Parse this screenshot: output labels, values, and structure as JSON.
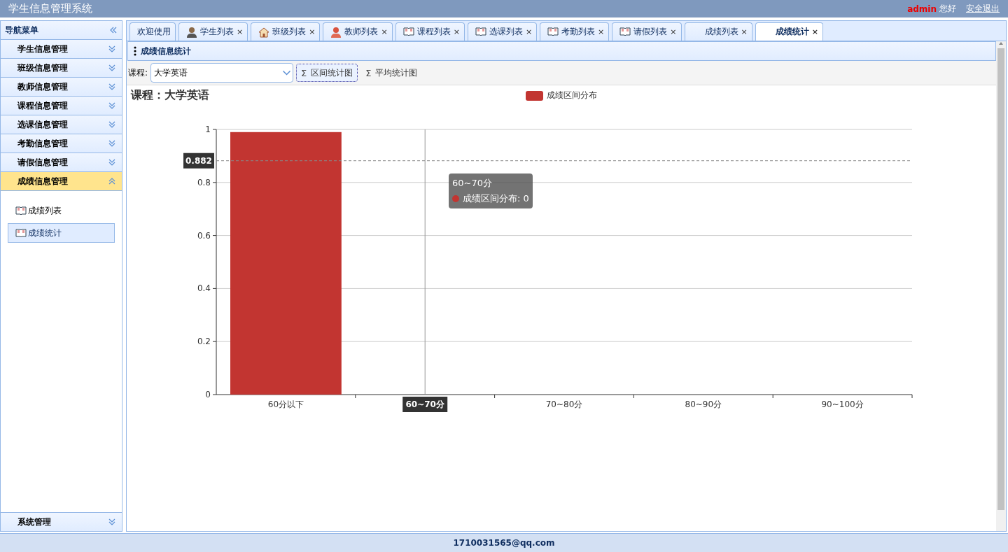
{
  "header": {
    "title": "学生信息管理系统",
    "user": "admin",
    "greeting": "您好",
    "logout": "安全退出"
  },
  "sidebar": {
    "title": "导航菜单",
    "sections": [
      {
        "label": "学生信息管理",
        "expanded": false
      },
      {
        "label": "班级信息管理",
        "expanded": false
      },
      {
        "label": "教师信息管理",
        "expanded": false
      },
      {
        "label": "课程信息管理",
        "expanded": false
      },
      {
        "label": "选课信息管理",
        "expanded": false
      },
      {
        "label": "考勤信息管理",
        "expanded": false
      },
      {
        "label": "请假信息管理",
        "expanded": false
      },
      {
        "label": "成绩信息管理",
        "expanded": true,
        "children": [
          {
            "label": "成绩列表",
            "selected": false
          },
          {
            "label": "成绩统计",
            "selected": true
          }
        ]
      }
    ],
    "bottom_section": {
      "label": "系统管理",
      "expanded": false
    }
  },
  "tabs": [
    {
      "label": "欢迎使用",
      "kind": "plain",
      "closable": false,
      "selected": false
    },
    {
      "label": "学生列表",
      "kind": "student",
      "closable": true,
      "selected": false
    },
    {
      "label": "班级列表",
      "kind": "house",
      "closable": true,
      "selected": false
    },
    {
      "label": "教师列表",
      "kind": "teacher",
      "closable": true,
      "selected": false
    },
    {
      "label": "课程列表",
      "kind": "book",
      "closable": true,
      "selected": false
    },
    {
      "label": "选课列表",
      "kind": "book",
      "closable": true,
      "selected": false
    },
    {
      "label": "考勤列表",
      "kind": "book",
      "closable": true,
      "selected": false
    },
    {
      "label": "请假列表",
      "kind": "book",
      "closable": true,
      "selected": false
    },
    {
      "label": "成绩列表",
      "kind": "plain",
      "closable": true,
      "selected": false
    },
    {
      "label": "成绩统计",
      "kind": "plain",
      "closable": true,
      "selected": true
    }
  ],
  "close_glyph": "×",
  "panel": {
    "title": "成绩信息统计"
  },
  "toolbar": {
    "course_label": "课程:",
    "course_value": "大学英语",
    "buttons": [
      {
        "glyph": "Σ",
        "label": "区间统计图",
        "selected": true
      },
      {
        "glyph": "Σ",
        "label": "平均统计图",
        "selected": false
      }
    ]
  },
  "chart": {
    "heading": "课程：大学英语",
    "tooltip": {
      "title": "60~70分",
      "line": "成绩区间分布: 0"
    },
    "chart_data": {
      "type": "bar",
      "categories": [
        "60分以下",
        "60~70分",
        "70~80分",
        "80~90分",
        "90~100分"
      ],
      "series": [
        {
          "name": "成绩区间分布",
          "color": "#c23531",
          "values": [
            0.99,
            0,
            0,
            0,
            0
          ]
        }
      ],
      "ylim": [
        0,
        1
      ],
      "yticks": [
        0,
        0.2,
        0.4,
        0.6,
        0.8,
        1
      ],
      "grid": true,
      "ref_lines": [
        {
          "axis": "x",
          "value": "60~70分"
        },
        {
          "axis": "y",
          "value": 0.882,
          "label": "0.882"
        }
      ]
    }
  },
  "footer": {
    "text": "1710031565@qq.com"
  }
}
